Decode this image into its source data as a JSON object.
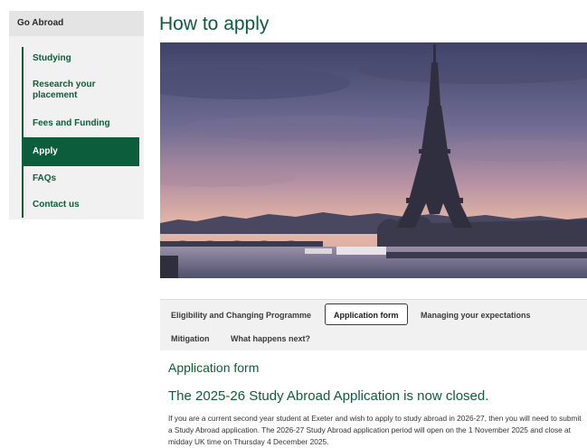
{
  "sidebar": {
    "header": "Go Abroad",
    "items": [
      {
        "label": "Studying",
        "active": false
      },
      {
        "label": "Research your placement",
        "active": false
      },
      {
        "label": "Fees and Funding",
        "active": false
      },
      {
        "label": "Apply",
        "active": true
      },
      {
        "label": "FAQs",
        "active": false
      },
      {
        "label": "Contact us",
        "active": false
      }
    ]
  },
  "main": {
    "title": "How to apply",
    "hero_image": {
      "subject": "eiffel-tower-seine-sunset",
      "sky_top": "#5a5d84",
      "sky_glow": "#e9b9a8"
    },
    "tabs": [
      {
        "label": "Eligibility and Changing Programme",
        "active": false
      },
      {
        "label": "Application form",
        "active": true
      },
      {
        "label": "Managing your expectations",
        "active": false
      },
      {
        "label": "Mitigation",
        "active": false
      },
      {
        "label": "What happens next?",
        "active": false
      }
    ],
    "section_heading": "Application form",
    "closed_heading": "The 2025-26 Study Abroad Application is now closed.",
    "paragraph": "If you are a current second year student at Exeter and wish to apply to study abroad in 2026-27, then you will need to submit a Study Abroad application. The 2026-27 Study Abroad application period will open on the 1 November 2025 and close at midday UK time on Thursday 4 December 2025."
  },
  "colors": {
    "brand_green": "#0b5d3b",
    "sidebar_bg": "#f1f1f1",
    "sidebar_header_bg": "#e4e4e4"
  }
}
